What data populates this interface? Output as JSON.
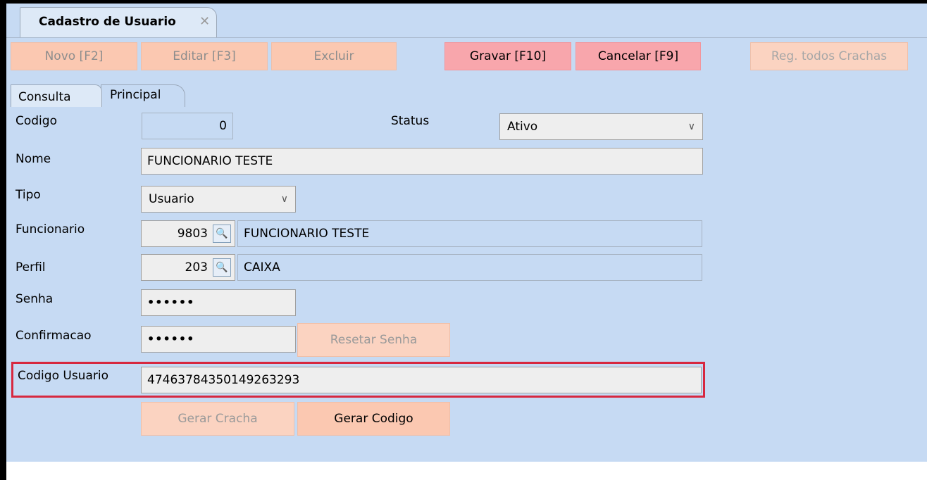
{
  "tab": {
    "title": "Cadastro de Usuario",
    "close": "✕"
  },
  "toolbar": {
    "novo": "Novo [F2]",
    "editar": "Editar [F3]",
    "excluir": "Excluir",
    "gravar": "Gravar [F10]",
    "cancelar": "Cancelar [F9]",
    "reg": "Reg. todos Crachas"
  },
  "page_tabs": {
    "consulta": "Consulta",
    "principal": "Principal"
  },
  "form": {
    "codigo_label": "Codigo",
    "codigo_value": "0",
    "status_label": "Status",
    "status_value": "Ativo",
    "nome_label": "Nome",
    "nome_value": "FUNCIONARIO TESTE",
    "tipo_label": "Tipo",
    "tipo_value": "Usuario",
    "funcionario_label": "Funcionario",
    "funcionario_code": "9803",
    "funcionario_name": "FUNCIONARIO TESTE",
    "perfil_label": "Perfil",
    "perfil_code": "203",
    "perfil_name": "CAIXA",
    "senha_label": "Senha",
    "senha_value": "••••••",
    "confirmacao_label": "Confirmacao",
    "confirmacao_value": "••••••",
    "resetar_label": "Resetar Senha",
    "codigo_usuario_label": "Codigo Usuario",
    "codigo_usuario_value": "47463784350149263293",
    "gerar_cracha_label": "Gerar Cracha",
    "gerar_codigo_label": "Gerar Codigo"
  },
  "icons": {
    "chevron": "∨",
    "search": "🔍"
  },
  "colors": {
    "background": "#c6daf3",
    "button_disabled": "#fbc8b1",
    "button_active": "#f8a6ac",
    "highlight": "#d7283f"
  }
}
